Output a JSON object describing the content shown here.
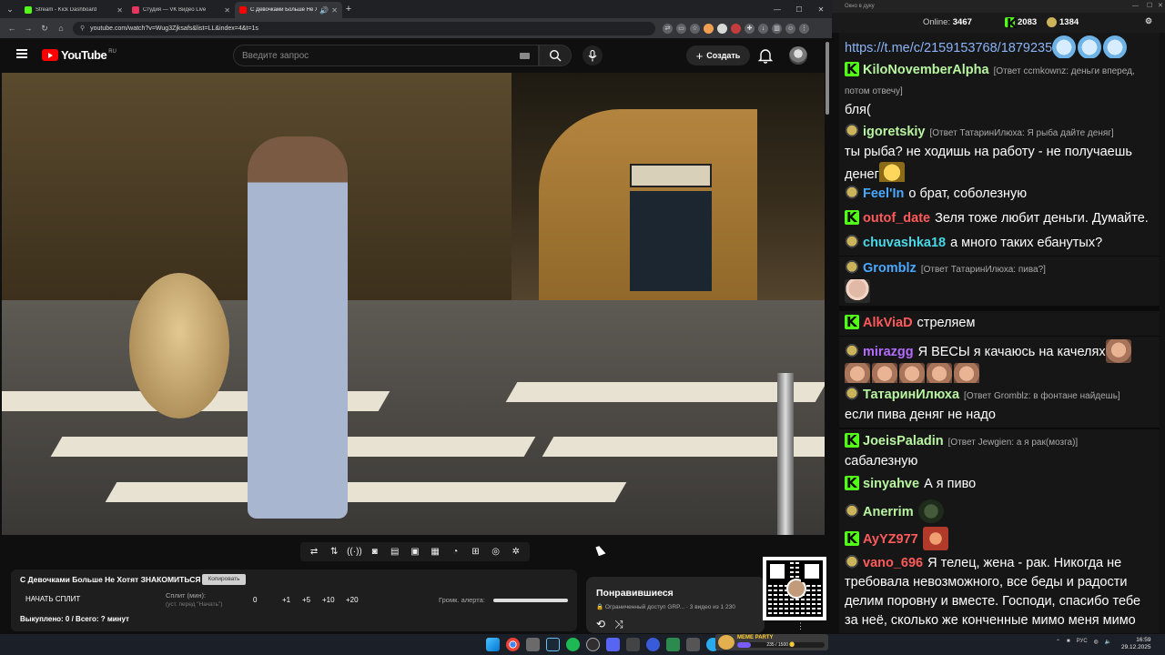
{
  "browser": {
    "tabs": [
      {
        "title": "Stream - Kick Dashboard",
        "color": "#53fc18",
        "active": false
      },
      {
        "title": "Студия — VK Видео Live",
        "color": "#e8355d",
        "active": false
      },
      {
        "title": "С Девочками Больше Не Х",
        "color": "#ff0000",
        "active": true
      }
    ],
    "new_tab": "+",
    "url": "youtube.com/watch?v=Wug3Zjksafs&list=LL&index=4&t=1s"
  },
  "youtube": {
    "logo_text": "YouTube",
    "region": "RU",
    "search_placeholder": "Введите запрос",
    "create_label": "Создать"
  },
  "player_tools": [
    "⇄",
    "⇅",
    "((·))",
    "◙",
    "▤",
    "▣",
    "▦",
    "◔",
    "⊞",
    "◎",
    "✲"
  ],
  "info_panel": {
    "title": "С Девочками Больше Не Хотят ЗНАКОМИТЬСЯ",
    "copy_label": "Копировать",
    "split_button": "НАЧАТЬ СПЛИТ",
    "split_label": "Сплит (мин):",
    "split_sub": "(уст. перед \"Начать\")",
    "split_value": "0",
    "split_steps": [
      "+1",
      "+5",
      "+10",
      "+20"
    ],
    "alert_label": "Громк. алерта:",
    "alert_volume": 1.0,
    "redeemed": "Выкуплено: 0 / Всего: ? минут"
  },
  "liked": {
    "title": "Понравившиеся",
    "subtitle": "🔒 Ограниченный доступ GRP... · 3 видео из 1 230",
    "icons": [
      "⟲",
      "⤨"
    ]
  },
  "meme_badge": {
    "title": "MEME PARTY",
    "progress_text": "235 / 1500 🪙",
    "progress": 0.157
  },
  "taskbar": {
    "lang": "РУС",
    "time": "16:59",
    "date": "29.12.2025"
  },
  "chat_window": {
    "title": "Окно в дуку",
    "online_label": "Online:",
    "online_value": "3467",
    "kick_count": "2083",
    "frog_count": "1384"
  },
  "chat": [
    {
      "badge": "",
      "user": "",
      "color": "#ffffff",
      "reply": "",
      "text": "https://t.me/c/2159153768/1879235",
      "link": true,
      "emotes_after": [
        "blue",
        "blue",
        "blue"
      ]
    },
    {
      "badge": "kick",
      "user": "KiloNovemberAlpha",
      "color": "#b8f5a0",
      "reply": "[Ответ ccmkownz: деньги вперед, потом отвечу]",
      "text": "бля("
    },
    {
      "badge": "frog",
      "user": "igoretskiy",
      "color": "#b8f5a0",
      "reply": "[Ответ ТатаринИлюха: Я рыба дайте деняг]",
      "text": "ты рыба? не ходишь на работу - не получаешь денег",
      "emotes_after": [
        "gold"
      ]
    },
    {
      "badge": "frog",
      "user": "Feel'In",
      "color": "#4aa8ff",
      "reply": "",
      "text": "о брат, соболезную"
    },
    {
      "badge": "kick",
      "user": "outof_date",
      "color": "#ff5a5a",
      "reply": "",
      "text": "Зеля тоже любит деньги. Думайте."
    },
    {
      "badge": "frog",
      "user": "chuvashka18",
      "color": "#4ad8e8",
      "reply": "",
      "text": "а много таких ебанутых?"
    },
    {
      "badge": "frog",
      "user": "Gromblz",
      "color": "#4aa8ff",
      "reply": "[Ответ ТатаринИлюха: пива?]",
      "text": "",
      "emotes_after": [
        "bald"
      ]
    },
    {
      "badge": "kick",
      "user": "AlkViaD",
      "color": "#ff5a5a",
      "reply": "",
      "text": "стреляем"
    },
    {
      "badge": "frog",
      "user": "mirazgg",
      "color": "#b46cff",
      "reply": "",
      "text": "Я ВЕСЫ я качаюсь на качелях",
      "emotes_after": [
        "face",
        "face",
        "face",
        "face",
        "face",
        "face"
      ]
    },
    {
      "badge": "frog",
      "user": "ТатаринИлюха",
      "color": "#b8f5a0",
      "reply": "[Ответ Grombl​z: в фонтане найдешь]",
      "text": "если пива деняг не надо"
    },
    {
      "badge": "kick",
      "user": "JoeisPaladin",
      "color": "#b8f5a0",
      "reply": "[Ответ Jewgien: а я рак(мозга)]",
      "text": "сабалезную"
    },
    {
      "badge": "kick",
      "user": "sinyahve",
      "color": "#b8f5a0",
      "reply": "",
      "text": "А я пиво"
    },
    {
      "badge": "frog",
      "user": "Anerrim",
      "color": "#b8f5a0",
      "reply": "",
      "text": "",
      "emotes_after": [
        "green"
      ]
    },
    {
      "badge": "kick",
      "user": "AyYZ977",
      "color": "#ff5a5a",
      "reply": "",
      "text": "",
      "emotes_after": [
        "red"
      ]
    },
    {
      "badge": "frog",
      "user": "vano_696",
      "color": "#ff5a5a",
      "reply": "",
      "text": "Я телец, жена - рак. Никогда не требовала невозможного, все беды и радости делим поровну и вместе. Господи, спасибо тебе за неё, сколько же конченные мимо меня мимо"
    }
  ]
}
